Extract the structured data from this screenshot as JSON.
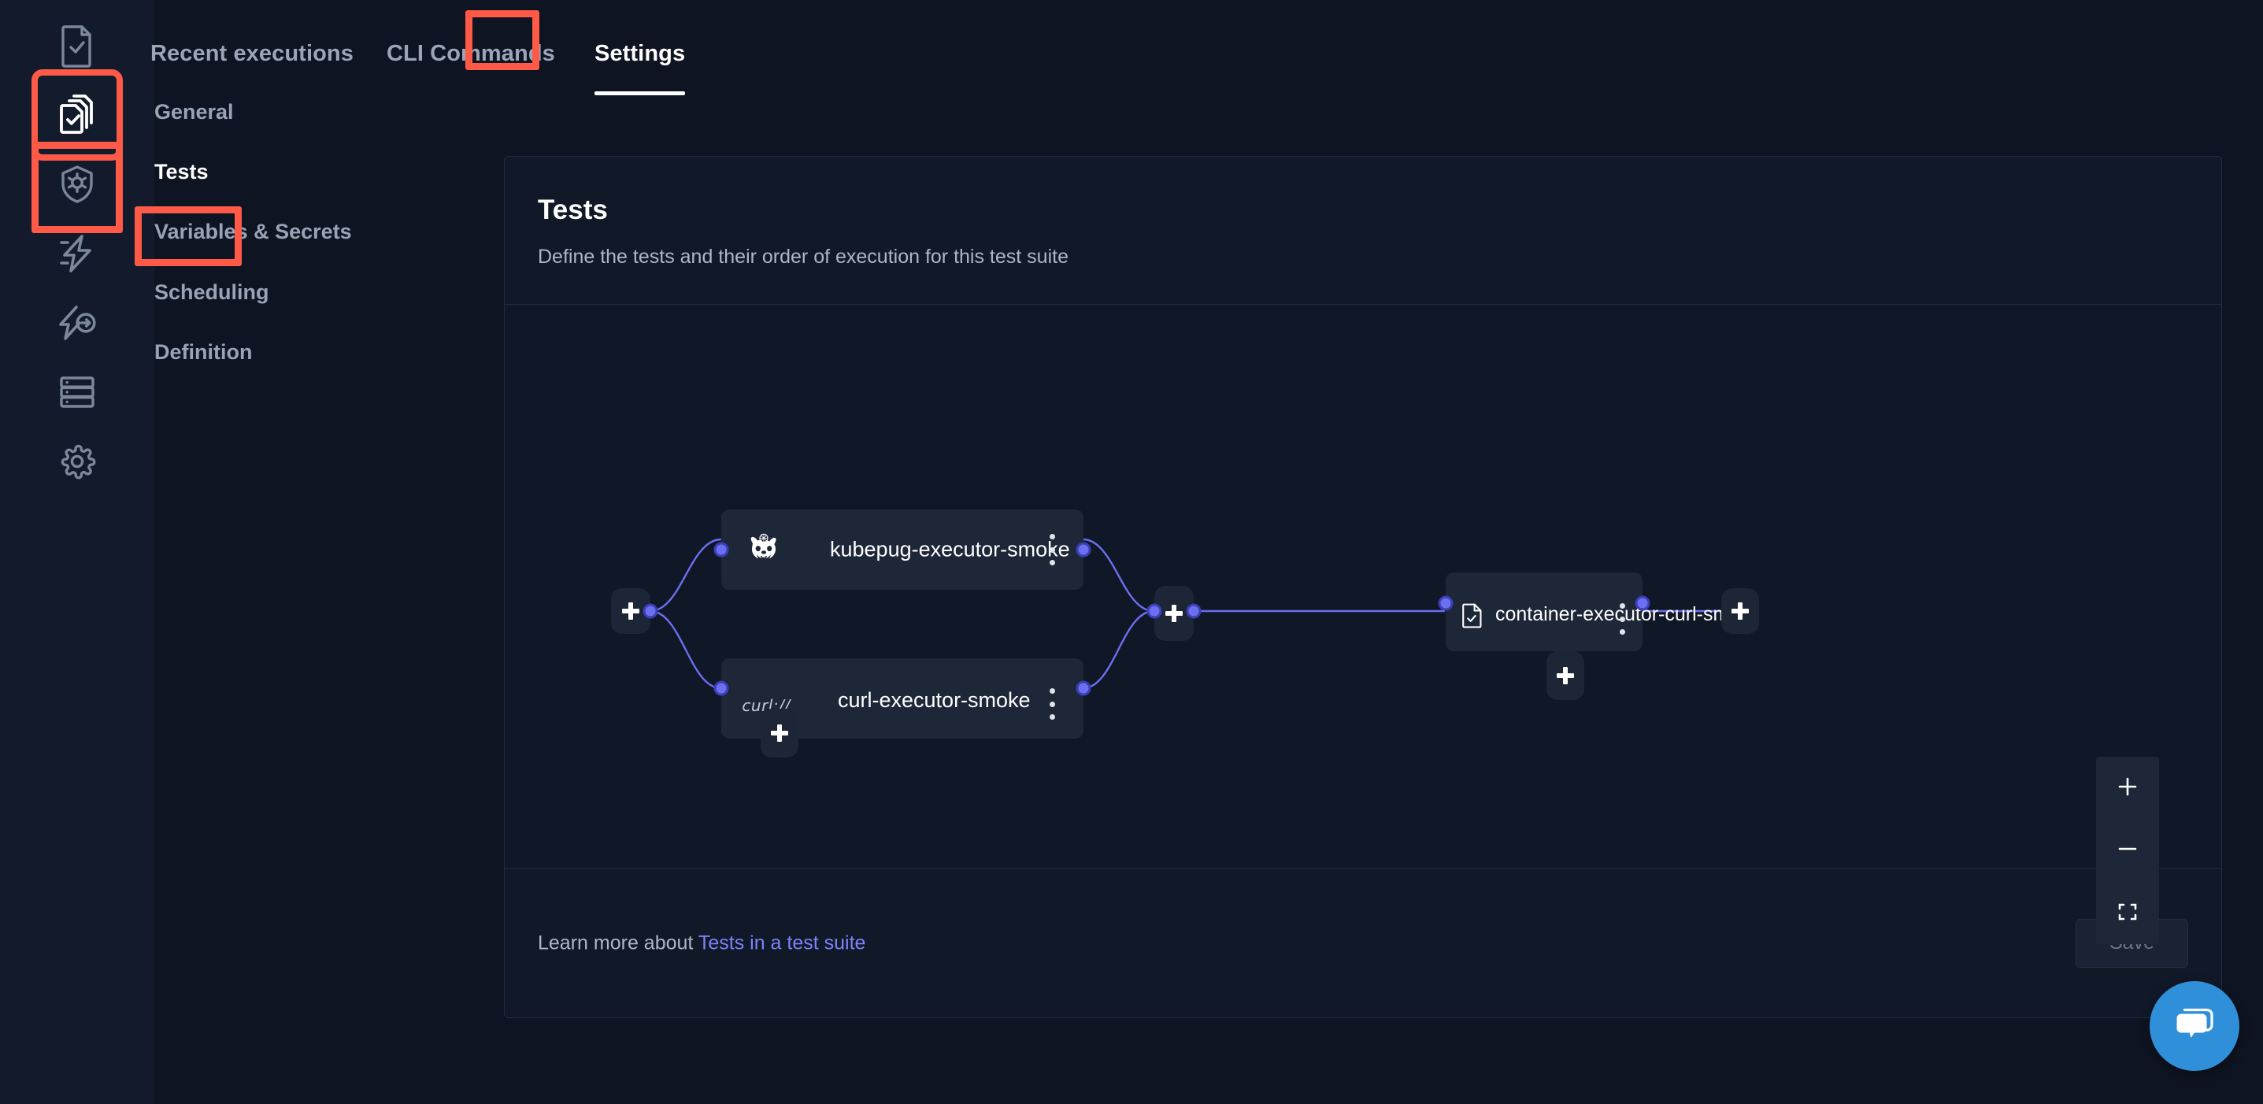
{
  "colors": {
    "page_bg": "#0e1421",
    "rail_bg": "#121a2b",
    "card_bg": "#111828",
    "canvas_bg": "#101726",
    "node_bg": "#1e2738",
    "annotation_red": "#ff5a47",
    "edge_purple": "#6c6ff0",
    "link_blue": "#7d83f7",
    "chat_blue": "#2f8fd8",
    "text_muted": "#9aa5b8",
    "text_white": "#ffffff"
  },
  "rail": {
    "items": [
      {
        "name": "tests",
        "icon": "document-check-icon",
        "active": false
      },
      {
        "name": "test-suites",
        "icon": "stacked-documents-check-icon",
        "active": true
      },
      {
        "name": "sources",
        "icon": "shield-gear-icon",
        "active": false
      },
      {
        "name": "triggers",
        "icon": "lightning-bolt-icon",
        "active": false
      },
      {
        "name": "webhooks",
        "icon": "lightning-arrow-icon",
        "active": false
      },
      {
        "name": "executors",
        "icon": "server-stack-icon",
        "active": false
      },
      {
        "name": "settings",
        "icon": "gear-icon",
        "active": false
      }
    ]
  },
  "tabs": [
    {
      "label": "Recent executions",
      "active": false
    },
    {
      "label": "CLI Commands",
      "active": false
    },
    {
      "label": "Settings",
      "active": true
    }
  ],
  "settings_nav": {
    "items": [
      {
        "label": "General",
        "active": false
      },
      {
        "label": "Tests",
        "active": true
      },
      {
        "label": "Variables & Secrets",
        "active": false
      },
      {
        "label": "Scheduling",
        "active": false
      },
      {
        "label": "Definition",
        "active": false
      }
    ]
  },
  "card": {
    "title": "Tests",
    "subtitle": "Define the tests and their order of execution for this test suite"
  },
  "flow": {
    "nodes": [
      {
        "id": "kubepug",
        "label": "kubepug-executor-smoke",
        "icon": "kubepug-pug-icon"
      },
      {
        "id": "curl",
        "label": "curl-executor-smoke",
        "icon": "curl-logo",
        "logo_text": "curl://"
      },
      {
        "id": "container",
        "label": "container-executor-curl-smo…",
        "icon": "document-check-icon"
      }
    ],
    "add_buttons": [
      {
        "name": "add-step-start"
      },
      {
        "name": "add-step-middle"
      },
      {
        "name": "add-step-end"
      },
      {
        "name": "add-parallel-step-left"
      },
      {
        "name": "add-parallel-step-right"
      }
    ],
    "menu_label": "more-options"
  },
  "zoom_controls": [
    {
      "name": "zoom-in",
      "glyph": "+"
    },
    {
      "name": "zoom-out",
      "glyph": "−"
    },
    {
      "name": "fit-view",
      "glyph": "⛶"
    }
  ],
  "footer": {
    "learn_prefix": "Learn more about ",
    "learn_link": "Tests in a test suite",
    "save_label": "Save"
  },
  "chat": {
    "name": "chat-widget",
    "icon": "chat-bubble-icon"
  }
}
